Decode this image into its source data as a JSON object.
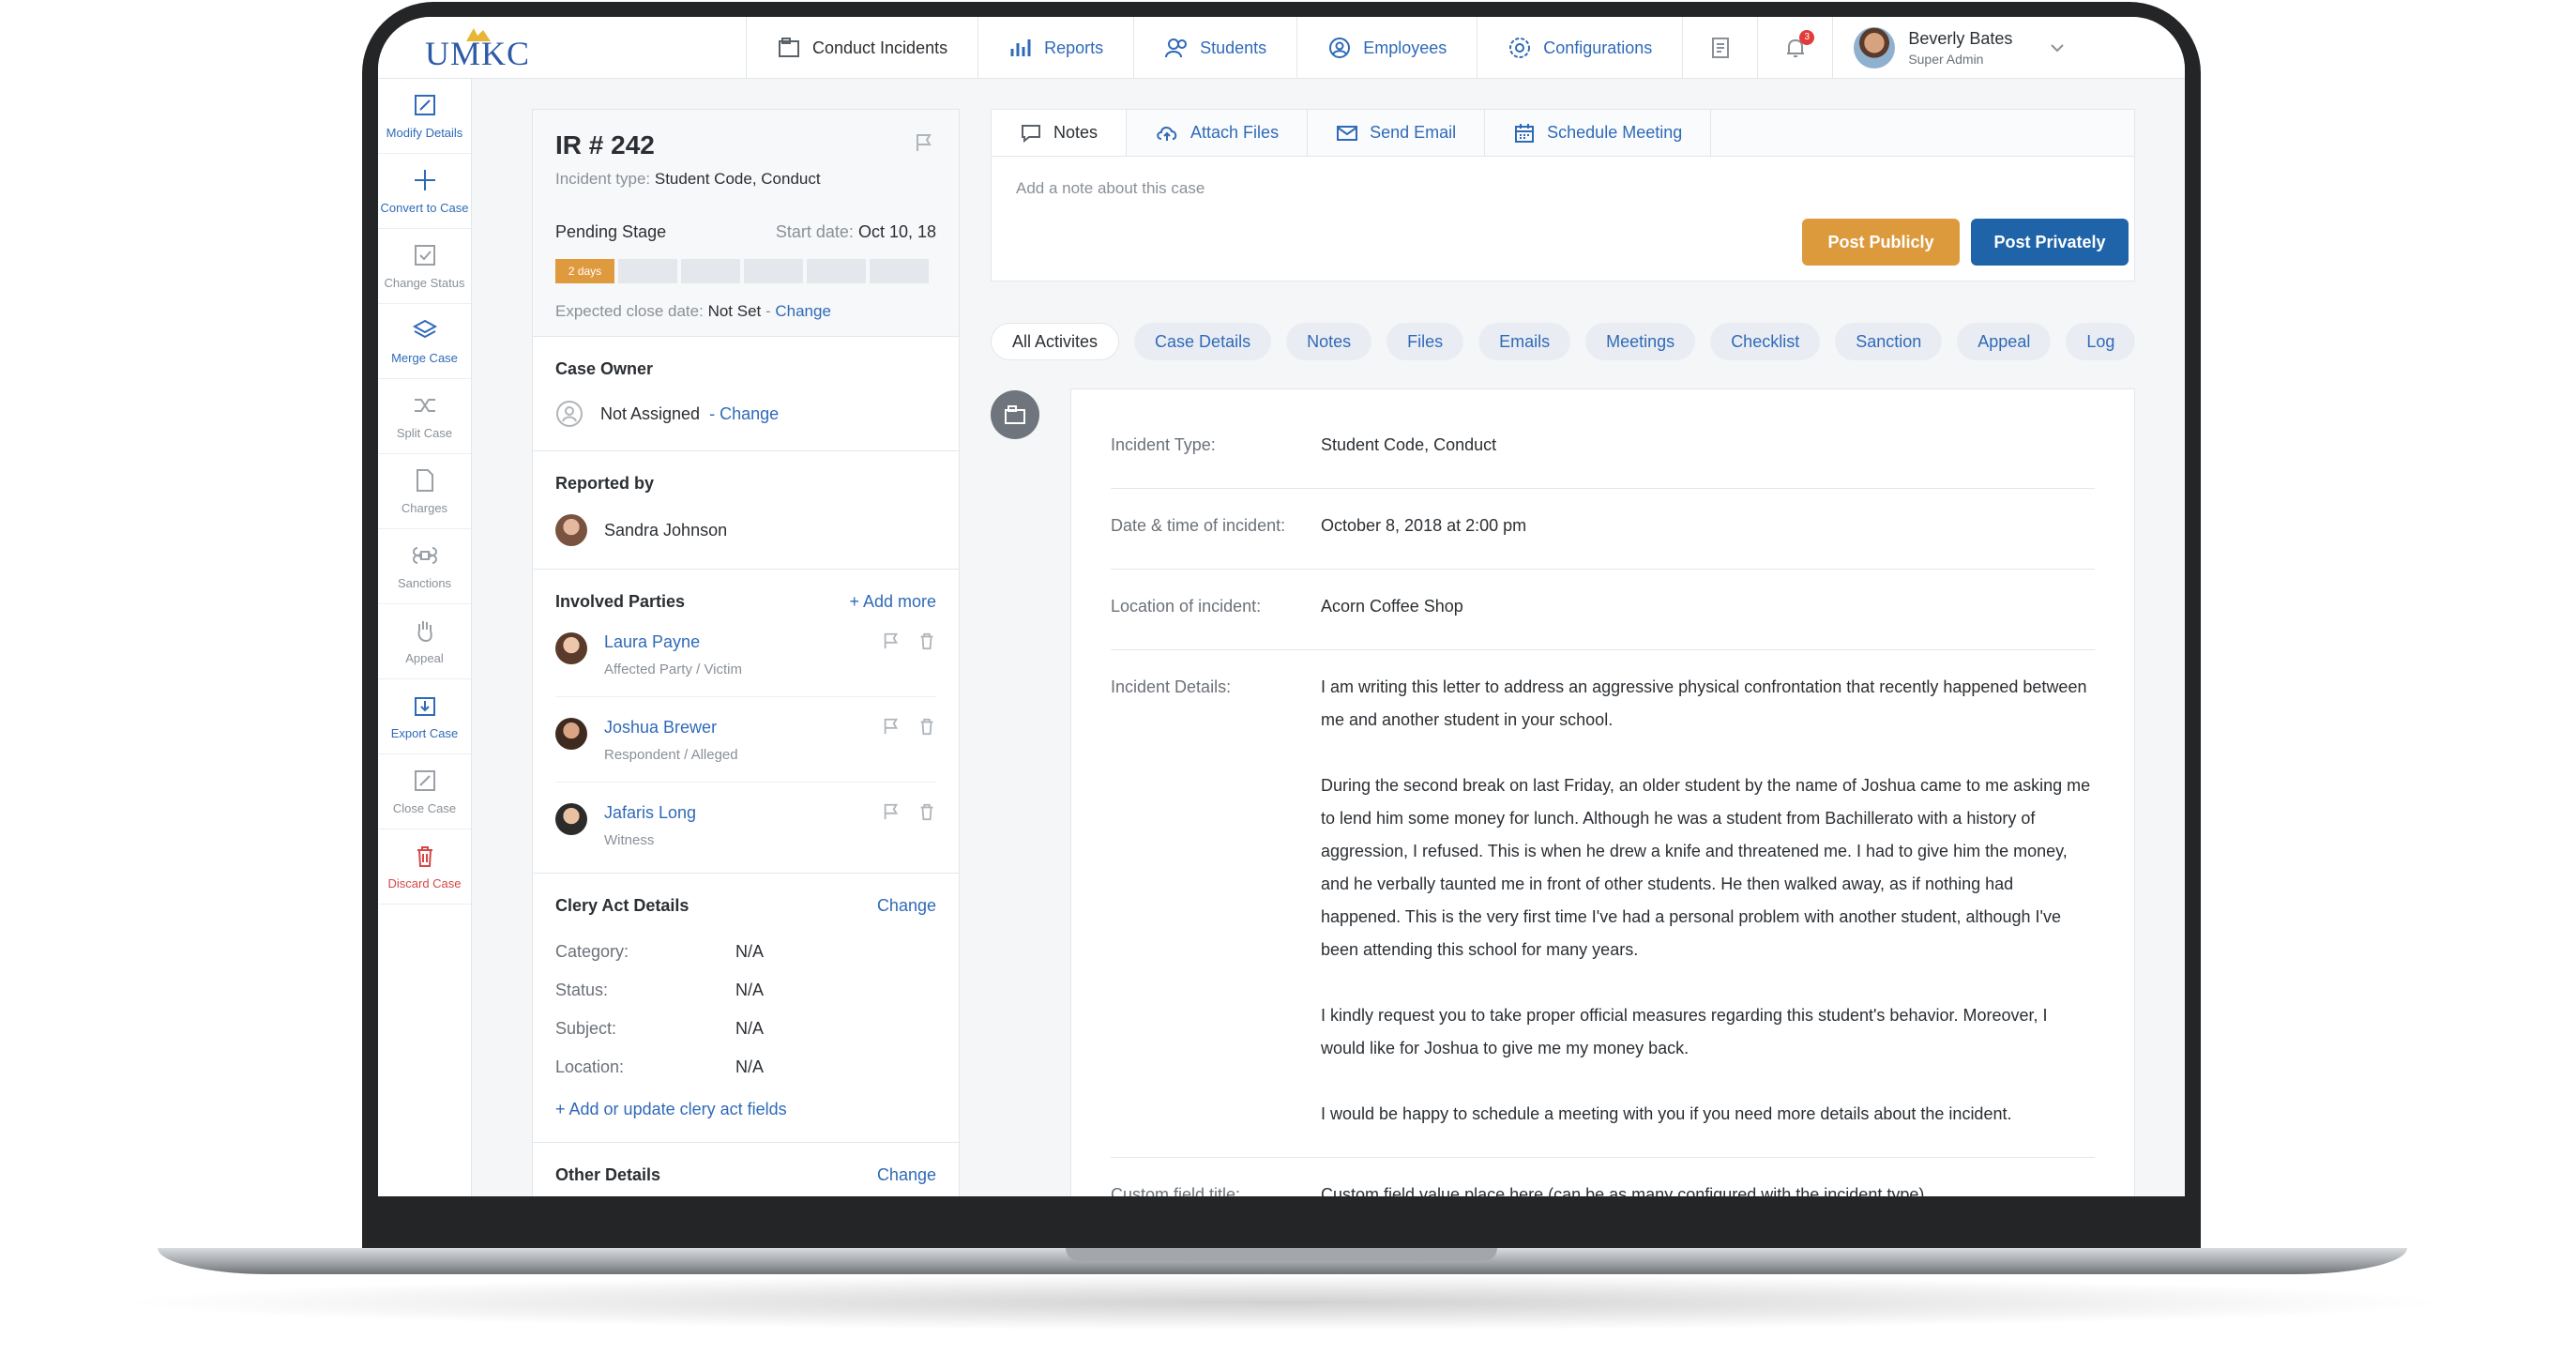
{
  "brand": {
    "logo": "UMKC"
  },
  "nav": {
    "items": [
      "Conduct Incidents",
      "Reports",
      "Students",
      "Employees",
      "Configurations"
    ],
    "notification_count": "3",
    "user": {
      "name": "Beverly Bates",
      "role": "Super Admin"
    }
  },
  "rail": {
    "items": [
      "Modify Details",
      "Convert to Case",
      "Change Status",
      "Merge Case",
      "Split Case",
      "Charges",
      "Sanctions",
      "Appeal",
      "Export Case",
      "Close Case",
      "Discard Case"
    ]
  },
  "case": {
    "title": "IR # 242",
    "type_label": "Incident type:",
    "type_value": "Student Code, Conduct",
    "stage": "Pending Stage",
    "start_label": "Start date:",
    "start_value": "Oct 10, 18",
    "progress_label": "2 days",
    "progress_fraction": 0.1667,
    "close_label": "Expected close date:",
    "close_value": "Not Set",
    "change": "Change",
    "owner_title": "Case Owner",
    "owner_value": "Not Assigned",
    "owner_change": "- Change",
    "reported_title": "Reported by",
    "reported_name": "Sandra Johnson",
    "parties_title": "Involved Parties",
    "add_more": "+ Add more",
    "parties": [
      {
        "name": "Laura Payne",
        "role": "Affected Party / Victim"
      },
      {
        "name": "Joshua Brewer",
        "role": "Respondent / Alleged"
      },
      {
        "name": "Jafaris Long",
        "role": "Witness"
      }
    ],
    "clery_title": "Clery Act Details",
    "clery_change": "Change",
    "clery": [
      {
        "k": "Category:",
        "v": "N/A"
      },
      {
        "k": "Status:",
        "v": "N/A"
      },
      {
        "k": "Subject:",
        "v": "N/A"
      },
      {
        "k": "Location:",
        "v": "N/A"
      }
    ],
    "clery_add": "+ Add or update clery act fields",
    "other_title": "Other Details",
    "other_change": "Change"
  },
  "composer": {
    "tabs": [
      "Notes",
      "Attach Files",
      "Send Email",
      "Schedule Meeting"
    ],
    "placeholder": "Add a note about this case",
    "post_public": "Post Publicly",
    "post_private": "Post Privately"
  },
  "pills": [
    "All Activites",
    "Case Details",
    "Notes",
    "Files",
    "Emails",
    "Meetings",
    "Checklist",
    "Sanction",
    "Appeal",
    "Log"
  ],
  "details": {
    "type_label": "Incident Type:",
    "type_value": "Student Code, Conduct",
    "date_label": "Date & time of incident:",
    "date_value": "October 8, 2018 at 2:00 pm",
    "location_label": "Location of incident:",
    "location_value": "Acorn Coffee Shop",
    "details_label": "Incident Details:",
    "paragraphs": [
      "I am writing this letter to address an aggressive physical confrontation that recently happened between me and another student in your school.",
      "During the second break on last Friday, an older student by the name of Joshua came to me asking me to lend him some money for lunch. Although he was a student from Bachillerato with a history of aggression, I refused. This is when he drew a knife and threatened me. I had to give him the money, and he verbally taunted me in front of other students. He then walked away, as if nothing had happened. This is the very first time I've had a personal problem with another student, although I've been attending this school for many years.",
      "I kindly request you to take proper official measures regarding this student's behavior. Moreover, I would like for Joshua to give me my money back.",
      "I would be happy to schedule a meeting with you if you need more details about the incident."
    ],
    "custom_label": "Custom field title:",
    "custom_value": "Custom field value place here (can be as many configured with the incident type)"
  },
  "colors": {
    "accent": "#2f6ab8",
    "orange": "#dd9a3d",
    "primary": "#1f64a8",
    "danger": "#d64545"
  }
}
